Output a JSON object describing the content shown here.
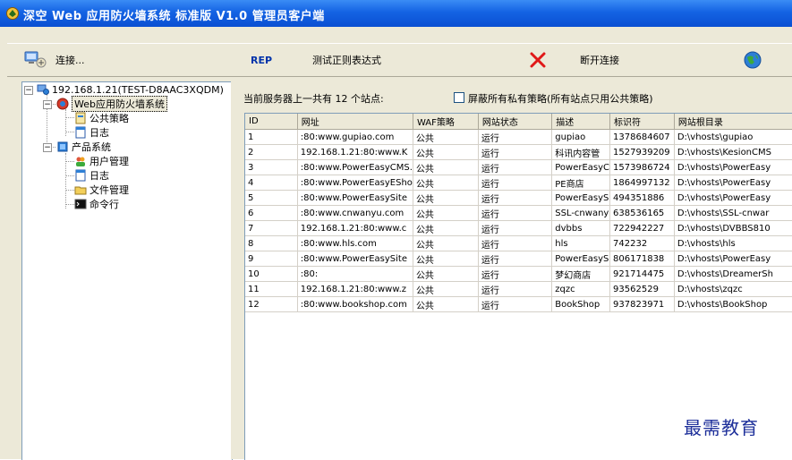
{
  "window": {
    "title": "深空 Web 应用防火墙系统 标准版 V1.0 管理员客户端"
  },
  "toolbar": {
    "connect_label": "连接...",
    "rep_label": "REP",
    "test_regex_label": "测试正则表达式",
    "disconnect_label": "断开连接"
  },
  "tree": {
    "root": "192.168.1.21(TEST-D8AAC3XQDM)",
    "waf": "Web应用防火墙系统",
    "public_policy": "公共策略",
    "log1": "日志",
    "product": "产品系统",
    "user_mgmt": "用户管理",
    "log2": "日志",
    "file_mgmt": "文件管理",
    "cmd": "命令行"
  },
  "summary": {
    "count_text": "当前服务器上一共有 12 个站点:",
    "shield_label": "屏蔽所有私有策略(所有站点只用公共策略)",
    "shield_checked": false
  },
  "table": {
    "headers": [
      "ID",
      "网址",
      "WAF策略",
      "网站状态",
      "描述",
      "标识符",
      "网站根目录"
    ],
    "rows": [
      [
        "1",
        ":80:www.gupiao.com",
        "公共",
        "运行",
        "gupiao",
        "1378684607",
        "D:\\vhosts\\gupiao"
      ],
      [
        "2",
        "192.168.1.21:80:www.K",
        "公共",
        "运行",
        "科讯内容管",
        "1527939209",
        "D:\\vhosts\\KesionCMS"
      ],
      [
        "3",
        ":80:www.PowerEasyCMS.",
        "公共",
        "运行",
        "PowerEasyC",
        "1573986724",
        "D:\\vhosts\\PowerEasy"
      ],
      [
        "4",
        ":80:www.PowerEasyESho",
        "公共",
        "运行",
        "PE商店",
        "1864997132",
        "D:\\vhosts\\PowerEasy"
      ],
      [
        "5",
        ":80:www.PowerEasySite",
        "公共",
        "运行",
        "PowerEasyS",
        "494351886",
        "D:\\vhosts\\PowerEasy"
      ],
      [
        "6",
        ":80:www.cnwanyu.com",
        "公共",
        "运行",
        "SSL-cnwany",
        "638536165",
        "D:\\vhosts\\SSL-cnwar"
      ],
      [
        "7",
        "192.168.1.21:80:www.c",
        "公共",
        "运行",
        "dvbbs",
        "722942227",
        "D:\\vhosts\\DVBBS810"
      ],
      [
        "8",
        ":80:www.hls.com",
        "公共",
        "运行",
        "hls",
        "742232",
        "D:\\vhosts\\hls"
      ],
      [
        "9",
        ":80:www.PowerEasySite",
        "公共",
        "运行",
        "PowerEasyS",
        "806171838",
        "D:\\vhosts\\PowerEasy"
      ],
      [
        "10",
        ":80:",
        "公共",
        "运行",
        "梦幻商店",
        "921714475",
        "D:\\vhosts\\DreamerSh"
      ],
      [
        "11",
        "192.168.1.21:80:www.z",
        "公共",
        "运行",
        "zqzc",
        "93562529",
        "D:\\vhosts\\zqzc"
      ],
      [
        "12",
        ":80:www.bookshop.com",
        "公共",
        "运行",
        "BookShop",
        "937823971",
        "D:\\vhosts\\BookShop"
      ]
    ]
  },
  "watermark": "最需教育"
}
